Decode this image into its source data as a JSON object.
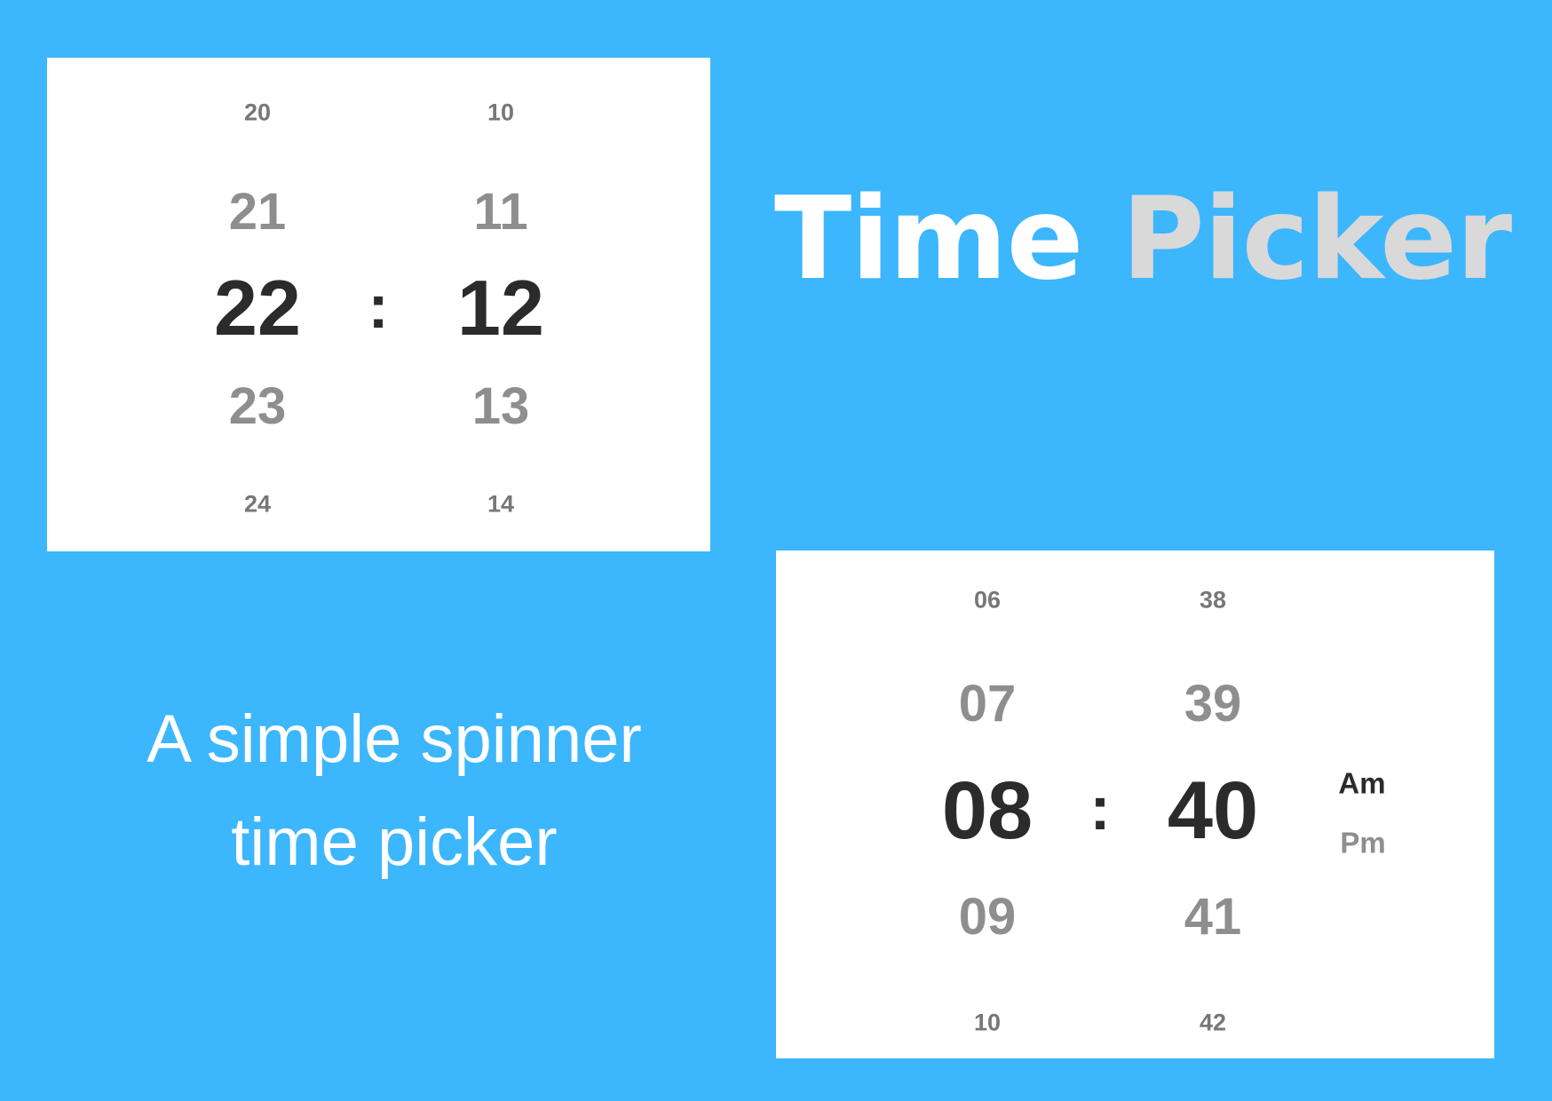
{
  "title": {
    "word1": "Time",
    "word2": "Picker"
  },
  "subtitle": {
    "line1": "A simple spinner",
    "line2": "time picker"
  },
  "picker24": {
    "hours": [
      "20",
      "21",
      "22",
      "23",
      "24"
    ],
    "minutes": [
      "10",
      "11",
      "12",
      "13",
      "14"
    ],
    "separator": ":"
  },
  "picker12": {
    "hours": [
      "06",
      "07",
      "08",
      "09",
      "10"
    ],
    "minutes": [
      "38",
      "39",
      "40",
      "41",
      "42"
    ],
    "separator": ":",
    "period": [
      "Am",
      "Pm"
    ]
  },
  "colors": {
    "background": "#3cb6fd",
    "card": "#ffffff",
    "selected_text": "#2b2b2b",
    "unselected_text": "#8e8e8e"
  }
}
